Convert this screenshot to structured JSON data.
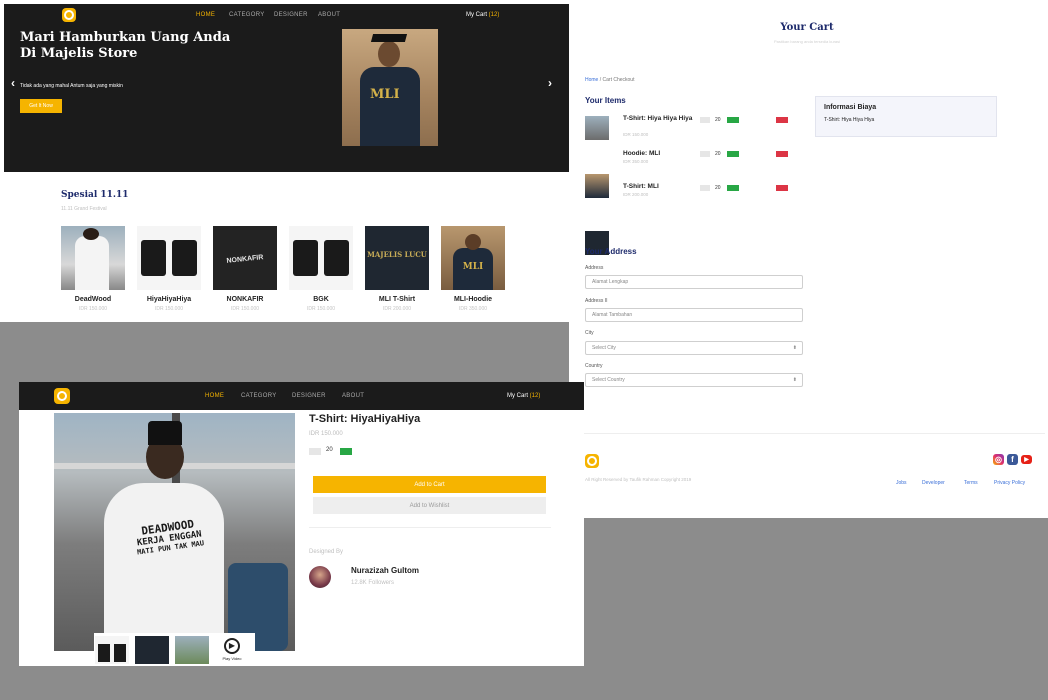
{
  "store": {
    "nav": {
      "home": "HOME",
      "category": "CATEGORY",
      "designer": "DESIGNER",
      "about": "ABOUT",
      "cart_label": "My Cart",
      "cart_count": "(12)"
    },
    "hero": {
      "title": "Mari Hamburkan Uang Anda Di Majelis Store",
      "subtitle": "Tidak ada yang mahal Antum saja yang miskin",
      "cta": "Get It Now",
      "image_text": "MLI"
    },
    "promo": {
      "title": "Spesial 11.11",
      "subtitle": "11.11 Grand Festival",
      "products": [
        {
          "name": "DeadWood",
          "price": "IDR 150.000"
        },
        {
          "name": "HiyaHiyaHiya",
          "price": "IDR 150.000"
        },
        {
          "name": "NONKAFIR",
          "price": "IDR 150.000"
        },
        {
          "name": "BGK",
          "price": "IDR 150.000"
        },
        {
          "name": "MLI T-Shirt",
          "price": "IDR 200.000"
        },
        {
          "name": "MLI-Hoodie",
          "price": "IDR 350.000"
        }
      ],
      "image_texts": {
        "nonkafir": "NONKAFIR",
        "majelis": "MAJELIS LUCU",
        "mli": "MLI"
      }
    }
  },
  "cart": {
    "title": "Your Cart",
    "subtitle": "Pastikan barang anda tersedia kurasi",
    "breadcrumb": {
      "home": "Home",
      "separator": "/",
      "current": "Cart Checkout"
    },
    "items_title": "Your Items",
    "items": [
      {
        "name": "T-Shirt: Hiya Hiya Hiya",
        "price": "IDR 150.000",
        "qty": "20"
      },
      {
        "name": "Hoodie: MLI",
        "price": "IDR 350.000",
        "qty": "20"
      },
      {
        "name": "T-Shirt: MLI",
        "price": "IDR 200.000",
        "qty": "20"
      }
    ],
    "info": {
      "title": "Informasi Biaya",
      "line": "T-Shirt: Hiya Hiya Hiya"
    },
    "address": {
      "title": "Your Address",
      "address_label": "Address",
      "address_placeholder": "Alamat Lengkap",
      "address2_label": "Address II",
      "address2_placeholder": "Alamat Tambahan",
      "city_label": "City",
      "city_placeholder": "Select City",
      "country_label": "Country",
      "country_placeholder": "Select Country"
    },
    "footer": {
      "copyright": "All Right Reserved by Taufik Rahman Copyright 2019",
      "links": [
        "Jobs",
        "Developer",
        "Terms",
        "Privacy Policy"
      ],
      "social": [
        "instagram-icon",
        "facebook-icon",
        "youtube-icon"
      ]
    }
  },
  "product": {
    "nav": {
      "home": "HOME",
      "category": "CATEGORY",
      "designer": "DESIGNER",
      "about": "ABOUT",
      "cart_label": "My Cart",
      "cart_count": "(12)"
    },
    "title": "T-Shirt: HiyaHiyaHiya",
    "price": "IDR 150.000",
    "qty": "20",
    "add_to_cart": "Add to Cart",
    "add_to_wishlist": "Add to Wishlist",
    "designed_by": "Designed By",
    "designer_name": "Nurazizah Gultom",
    "designer_followers": "12.8K Followers",
    "shirt_text": [
      "DEADWOOD",
      "KERJA ENGGAN",
      "MATI PUN TAK MAU"
    ],
    "play_video": "Play Video"
  },
  "colors": {
    "accent": "#f6b400",
    "navy": "#1d2a6b",
    "green": "#28a745",
    "red": "#dc3545",
    "dark": "#1b1b1b"
  }
}
